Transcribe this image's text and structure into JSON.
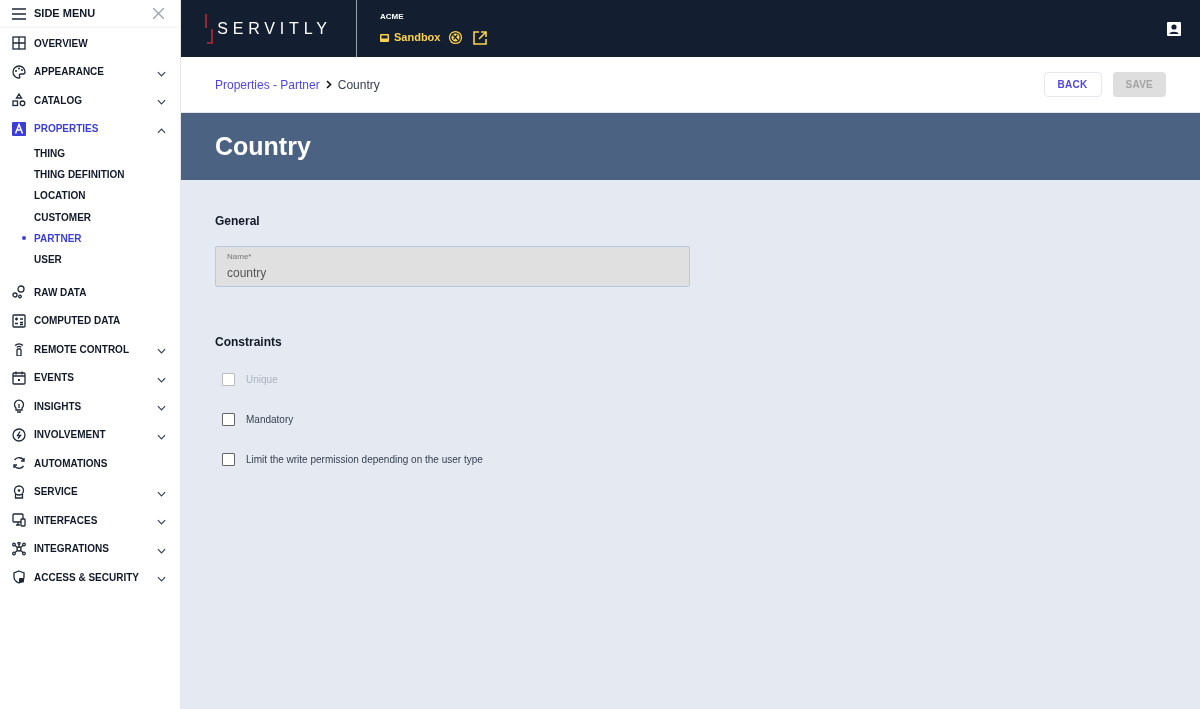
{
  "side_menu": {
    "title": "SIDE MENU",
    "items": [
      {
        "label": "OVERVIEW",
        "selected": false
      },
      {
        "label": "APPEARANCE",
        "selected": false,
        "expanded": false
      },
      {
        "label": "CATALOG",
        "selected": false,
        "expanded": false
      },
      {
        "label": "PROPERTIES",
        "selected": true,
        "expanded": true,
        "children": [
          {
            "label": "THING",
            "selected": false
          },
          {
            "label": "THING DEFINITION",
            "selected": false
          },
          {
            "label": "LOCATION",
            "selected": false
          },
          {
            "label": "CUSTOMER",
            "selected": false
          },
          {
            "label": "PARTNER",
            "selected": true
          },
          {
            "label": "USER",
            "selected": false
          }
        ]
      },
      {
        "label": "RAW DATA",
        "selected": false
      },
      {
        "label": "COMPUTED DATA",
        "selected": false
      },
      {
        "label": "REMOTE CONTROL",
        "selected": false,
        "expanded": false
      },
      {
        "label": "EVENTS",
        "selected": false,
        "expanded": false
      },
      {
        "label": "INSIGHTS",
        "selected": false,
        "expanded": false
      },
      {
        "label": "INVOLVEMENT",
        "selected": false,
        "expanded": false
      },
      {
        "label": "AUTOMATIONS",
        "selected": false
      },
      {
        "label": "SERVICE",
        "selected": false,
        "expanded": false
      },
      {
        "label": "INTERFACES",
        "selected": false,
        "expanded": false
      },
      {
        "label": "INTEGRATIONS",
        "selected": false,
        "expanded": false
      },
      {
        "label": "ACCESS & SECURITY",
        "selected": false,
        "expanded": false
      }
    ]
  },
  "top_bar": {
    "logo": "SERVITLY",
    "tenant": "ACME",
    "environment": "Sandbox"
  },
  "breadcrumb": [
    "Properties - Partner",
    "Country"
  ],
  "buttons": [
    {
      "label": "BACK",
      "disabled": false
    },
    {
      "label": "SAVE",
      "disabled": true
    }
  ],
  "page_title": "Country",
  "sections": [
    {
      "title": "General",
      "field": {
        "label": "Name*",
        "value": "country"
      }
    },
    {
      "title": "Constraints",
      "checkboxes": [
        {
          "label": "Unique",
          "checked": false,
          "disabled": true
        },
        {
          "label": "Mandatory",
          "checked": false,
          "disabled": false
        },
        {
          "label": "Limit the write permission depending on the user type",
          "checked": false,
          "disabled": false
        }
      ]
    }
  ]
}
